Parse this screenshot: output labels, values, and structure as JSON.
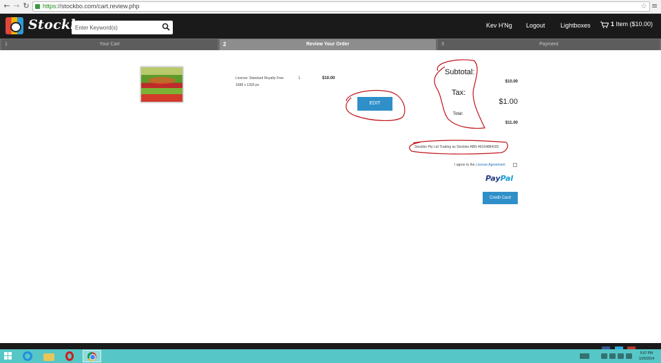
{
  "browser": {
    "url_scheme": "https",
    "url_rest": "://stockbo.com/cart.review.php"
  },
  "header": {
    "logo_text": "Stockbo",
    "search_placeholder": "Enter Keyword(s)",
    "user_name": "Kev H'Ng",
    "logout_label": "Logout",
    "lightboxes_label": "Lightboxes",
    "cart_count": "1",
    "cart_label": "Item ($10.00)"
  },
  "steps": [
    {
      "num": "1",
      "label": "Your Cart"
    },
    {
      "num": "2",
      "label": "Review Your Order"
    },
    {
      "num": "3",
      "label": "Payment"
    }
  ],
  "item": {
    "license_text": "License: Standard Royalty Free",
    "dimensions": "1688 x 1393 px",
    "qty": "1",
    "price": "$10.00",
    "edit_label": "EDIT"
  },
  "summary": {
    "subtotal_label": "Subtotal:",
    "subtotal_value": "$10.00",
    "tax_label": "Tax:",
    "tax_value": "$1.00",
    "total_label": "Total:",
    "total_value": "$11.00"
  },
  "company_text": "Stockbo Pty Ltd Trading as Stockbo ABN 46164884182",
  "agreement": {
    "prefix": "I agree to the",
    "link": "License Agreement"
  },
  "paypal": {
    "part1": "Pay",
    "part2": "Pal"
  },
  "credit_card_label": "Credit Card",
  "taskbar": {
    "time": "5:57 PM",
    "date": "1/25/2014"
  },
  "colors": {
    "header_bg": "#1a1a1a",
    "button_blue": "#2f8fc9",
    "annotation_red": "#c0141a",
    "taskbar": "#56c6c6"
  }
}
